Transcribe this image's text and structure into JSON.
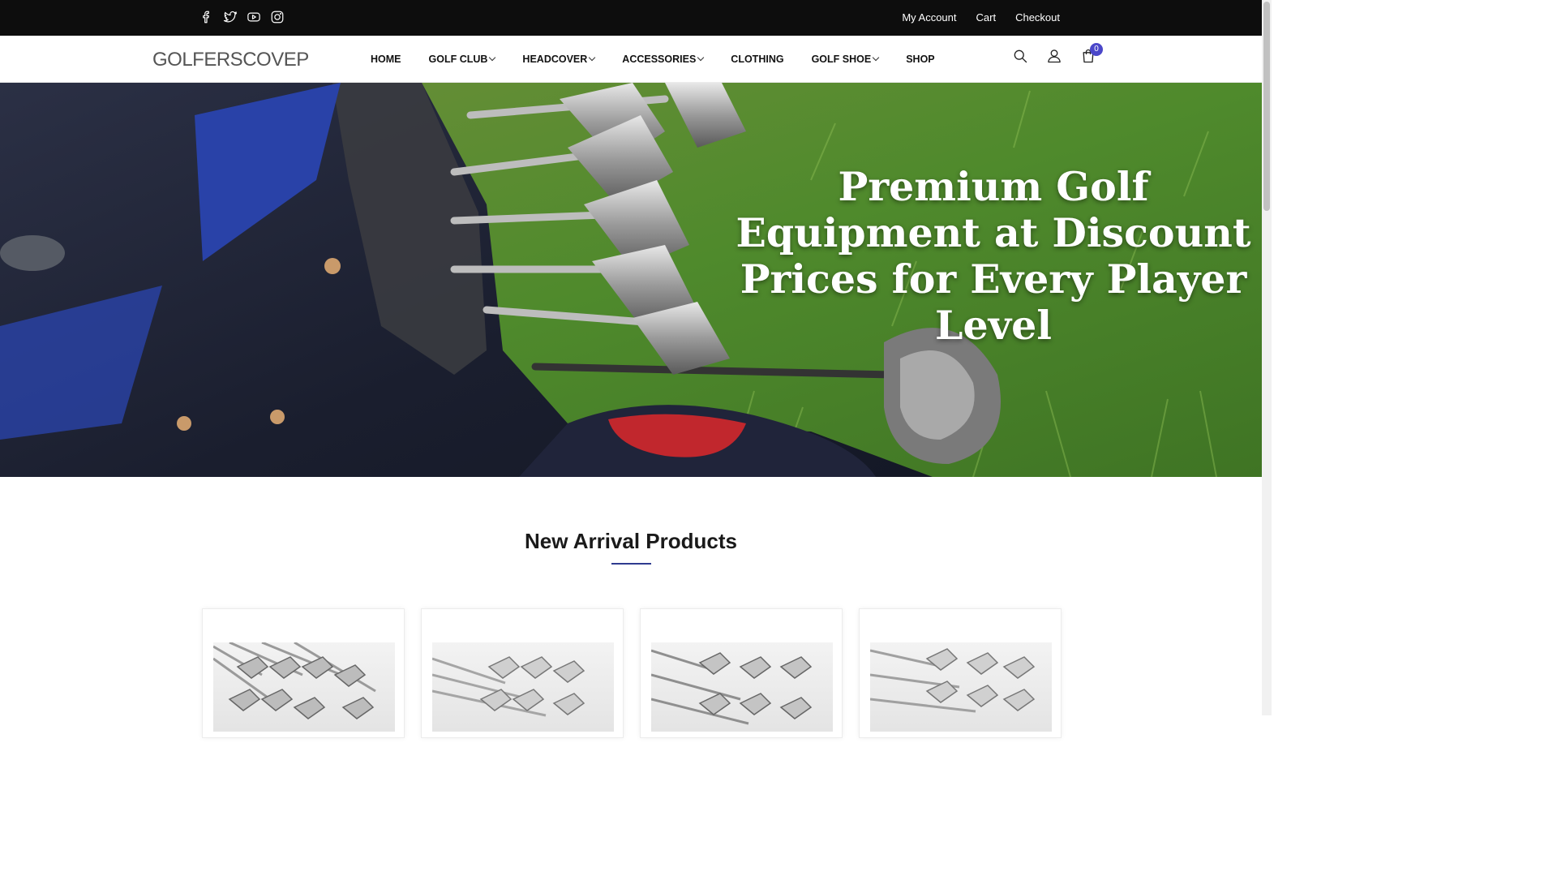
{
  "topbar": {
    "social_icons": [
      "facebook-icon",
      "twitter-icon",
      "youtube-icon",
      "instagram-icon"
    ],
    "links": [
      "My Account",
      "Cart",
      "Checkout"
    ]
  },
  "header": {
    "logo": "GOLFERSCOVEP",
    "nav": [
      {
        "label": "HOME",
        "dropdown": false
      },
      {
        "label": "GOLF CLUB",
        "dropdown": true
      },
      {
        "label": "HEADCOVER",
        "dropdown": true
      },
      {
        "label": "ACCESSORIES",
        "dropdown": true
      },
      {
        "label": "CLOTHING",
        "dropdown": false
      },
      {
        "label": "GOLF SHOE",
        "dropdown": true
      },
      {
        "label": "SHOP",
        "dropdown": false
      }
    ],
    "icons": [
      "search-icon",
      "user-icon",
      "shopping-bag-icon"
    ],
    "cart_count": "0"
  },
  "hero": {
    "title": "Premium Golf Equipment at Discount Prices for Every Player Level"
  },
  "section": {
    "title": "New Arrival Products"
  },
  "colors": {
    "topbar_bg": "#0d0d0d",
    "accent": "#4b47c9",
    "underline": "#2f3b8f"
  }
}
